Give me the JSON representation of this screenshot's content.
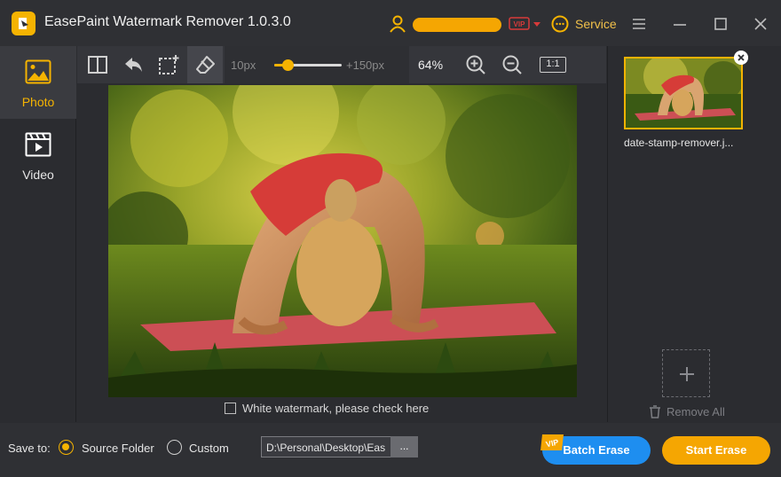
{
  "app": {
    "title": "EasePaint Watermark Remover  1.0.3.0",
    "service_label": "Service",
    "vip_label": "VIP",
    "accent_color": "#f5b301",
    "icons": [
      "app-logo-icon",
      "user-icon",
      "vip-icon",
      "chevron-down-icon",
      "service-chat-icon",
      "menu-icon",
      "minimize-icon",
      "maximize-icon",
      "close-icon"
    ]
  },
  "sidebar": {
    "items": [
      {
        "label": "Photo",
        "icon": "photo-icon",
        "active": true
      },
      {
        "label": "Video",
        "icon": "video-icon",
        "active": false
      }
    ]
  },
  "toolbar": {
    "brush_min": "10px",
    "brush_max": "+150px",
    "brush_level_fraction": 0.2,
    "zoom": "64%",
    "one_to_one": "1:1",
    "icons": [
      "compare-icon",
      "undo-icon",
      "select-rect-icon",
      "eraser-icon",
      "zoom-in-icon",
      "zoom-out-icon"
    ]
  },
  "canvas": {
    "white_watermark_label": "White watermark, please check here"
  },
  "files": {
    "items": [
      {
        "name": "date-stamp-remover.j..."
      }
    ],
    "remove_all": "Remove All"
  },
  "bottom": {
    "save_to": "Save to:",
    "source_folder": "Source Folder",
    "custom": "Custom",
    "path": "D:\\Personal\\Desktop\\Eas",
    "browse": "...",
    "batch_erase": "Batch Erase",
    "batch_vip": "VIP",
    "start_erase": "Start Erase"
  }
}
